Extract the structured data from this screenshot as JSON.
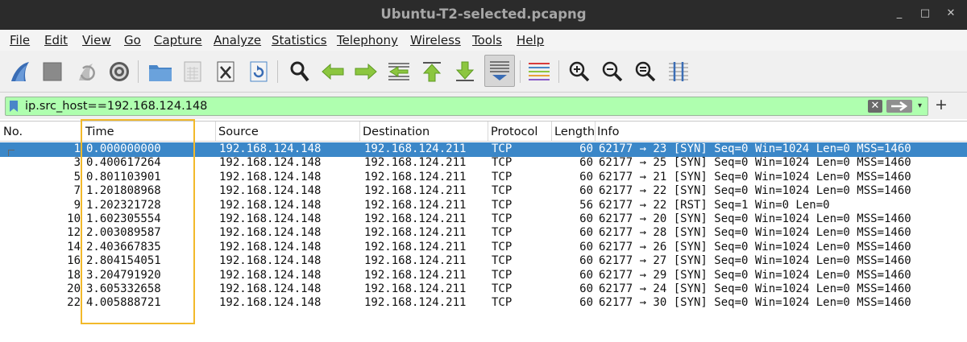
{
  "window": {
    "title": "Ubuntu-T2-selected.pcapng"
  },
  "window_controls": {
    "minimize": "_",
    "maximize": "□",
    "close": "✕"
  },
  "menu": [
    {
      "label": "File"
    },
    {
      "label": "Edit"
    },
    {
      "label": "View"
    },
    {
      "label": "Go"
    },
    {
      "label": "Capture"
    },
    {
      "label": "Analyze"
    },
    {
      "label": "Statistics"
    },
    {
      "label": "Telephony"
    },
    {
      "label": "Wireless"
    },
    {
      "label": "Tools"
    },
    {
      "label": "Help"
    }
  ],
  "toolbar": {
    "icons": [
      "shark-fin-start-icon",
      "stop-capture-icon",
      "restart-capture-icon",
      "capture-options-gear-icon",
      "open-folder-icon",
      "save-file-icon",
      "close-file-icon",
      "reload-file-icon",
      "find-packet-icon",
      "go-back-icon",
      "go-forward-icon",
      "go-to-packet-icon",
      "go-first-icon",
      "go-last-icon",
      "auto-scroll-icon",
      "colorize-icon",
      "zoom-in-icon",
      "zoom-out-icon",
      "zoom-normal-icon",
      "resize-columns-icon"
    ]
  },
  "filter": {
    "value": "ip.src_host==192.168.124.148",
    "background": "#afffaf"
  },
  "columns": [
    "No.",
    "Time",
    "Source",
    "Destination",
    "Protocol",
    "Length",
    "Info"
  ],
  "packets": [
    {
      "no": "1",
      "time": "0.000000000",
      "src": "192.168.124.148",
      "dst": "192.168.124.211",
      "proto": "TCP",
      "len": "60",
      "info": "62177 → 23 [SYN] Seq=0 Win=1024 Len=0 MSS=1460",
      "selected": true
    },
    {
      "no": "3",
      "time": "0.400617264",
      "src": "192.168.124.148",
      "dst": "192.168.124.211",
      "proto": "TCP",
      "len": "60",
      "info": "62177 → 25 [SYN] Seq=0 Win=1024 Len=0 MSS=1460"
    },
    {
      "no": "5",
      "time": "0.801103901",
      "src": "192.168.124.148",
      "dst": "192.168.124.211",
      "proto": "TCP",
      "len": "60",
      "info": "62177 → 21 [SYN] Seq=0 Win=1024 Len=0 MSS=1460"
    },
    {
      "no": "7",
      "time": "1.201808968",
      "src": "192.168.124.148",
      "dst": "192.168.124.211",
      "proto": "TCP",
      "len": "60",
      "info": "62177 → 22 [SYN] Seq=0 Win=1024 Len=0 MSS=1460"
    },
    {
      "no": "9",
      "time": "1.202321728",
      "src": "192.168.124.148",
      "dst": "192.168.124.211",
      "proto": "TCP",
      "len": "56",
      "info": "62177 → 22 [RST] Seq=1 Win=0 Len=0"
    },
    {
      "no": "10",
      "time": "1.602305554",
      "src": "192.168.124.148",
      "dst": "192.168.124.211",
      "proto": "TCP",
      "len": "60",
      "info": "62177 → 20 [SYN] Seq=0 Win=1024 Len=0 MSS=1460"
    },
    {
      "no": "12",
      "time": "2.003089587",
      "src": "192.168.124.148",
      "dst": "192.168.124.211",
      "proto": "TCP",
      "len": "60",
      "info": "62177 → 28 [SYN] Seq=0 Win=1024 Len=0 MSS=1460"
    },
    {
      "no": "14",
      "time": "2.403667835",
      "src": "192.168.124.148",
      "dst": "192.168.124.211",
      "proto": "TCP",
      "len": "60",
      "info": "62177 → 26 [SYN] Seq=0 Win=1024 Len=0 MSS=1460"
    },
    {
      "no": "16",
      "time": "2.804154051",
      "src": "192.168.124.148",
      "dst": "192.168.124.211",
      "proto": "TCP",
      "len": "60",
      "info": "62177 → 27 [SYN] Seq=0 Win=1024 Len=0 MSS=1460"
    },
    {
      "no": "18",
      "time": "3.204791920",
      "src": "192.168.124.148",
      "dst": "192.168.124.211",
      "proto": "TCP",
      "len": "60",
      "info": "62177 → 29 [SYN] Seq=0 Win=1024 Len=0 MSS=1460"
    },
    {
      "no": "20",
      "time": "3.605332658",
      "src": "192.168.124.148",
      "dst": "192.168.124.211",
      "proto": "TCP",
      "len": "60",
      "info": "62177 → 24 [SYN] Seq=0 Win=1024 Len=0 MSS=1460"
    },
    {
      "no": "22",
      "time": "4.005888721",
      "src": "192.168.124.148",
      "dst": "192.168.124.211",
      "proto": "TCP",
      "len": "60",
      "info": "62177 → 30 [SYN] Seq=0 Win=1024 Len=0 MSS=1460"
    }
  ],
  "colors": {
    "selection": "#3b87c8",
    "highlight_box": "#f2b92a",
    "titlebar": "#2b2b2b"
  }
}
